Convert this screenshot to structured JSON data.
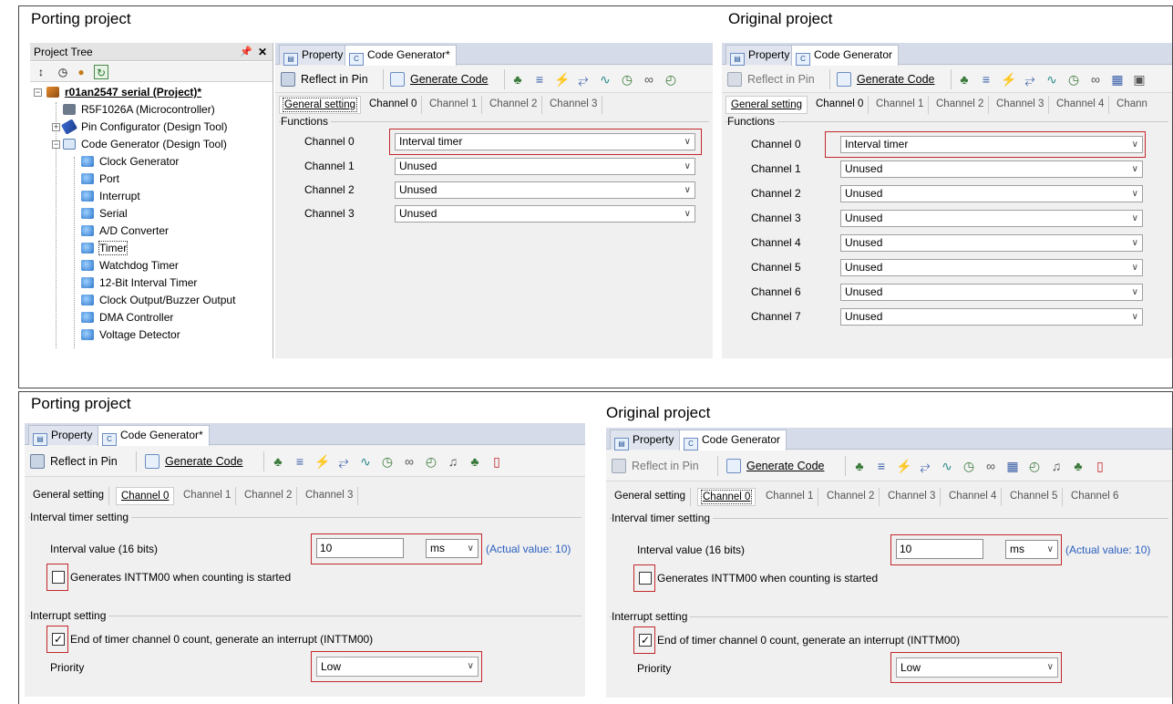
{
  "captions": {
    "top_left": "Porting project",
    "top_right": "Original project",
    "bottom_left": "Porting project",
    "bottom_right": "Original project"
  },
  "project_tree": {
    "title": "Project Tree",
    "pin": "  p",
    "close": "✕",
    "nodes": [
      "r01an2547 serial (Project)*",
      "R5F1026A (Microcontroller)",
      "Pin Configurator (Design Tool)",
      "Code Generator (Design Tool)",
      "Clock Generator",
      "Port",
      "Interrupt",
      "Serial",
      "A/D Converter",
      "Timer",
      "Watchdog Timer",
      "12-Bit Interval Timer",
      "Clock Output/Buzzer Output",
      "DMA Controller",
      "Voltage Detector"
    ]
  },
  "doc_tabs": {
    "property": "Property",
    "codegen_porting": "Code Generator*",
    "codegen_original": "Code Generator"
  },
  "toolbar": {
    "reflect": "Reflect in Pin",
    "generate": "Generate Code"
  },
  "periph_tabs": {
    "general": "General setting",
    "channels": [
      "Channel 0",
      "Channel 1",
      "Channel 2",
      "Channel 3",
      "Channel 4",
      "Channel 5",
      "Channel 6",
      "Chann"
    ]
  },
  "functions": {
    "group": "Functions",
    "channel_labels": [
      "Channel 0",
      "Channel 1",
      "Channel 2",
      "Channel 3",
      "Channel 4",
      "Channel 5",
      "Channel 6",
      "Channel 7"
    ],
    "porting_values": [
      "Interval timer",
      "Unused",
      "Unused",
      "Unused"
    ],
    "original_values": [
      "Interval timer",
      "Unused",
      "Unused",
      "Unused",
      "Unused",
      "Unused",
      "Unused",
      "Unused"
    ]
  },
  "channel0": {
    "interval_group": "Interval timer setting",
    "interval_label": "Interval value (16 bits)",
    "interval_value": "10",
    "unit": "ms",
    "actual": "(Actual value: 10)",
    "start_label": "Generates INTTM00 when counting is started",
    "start_checked": false,
    "interrupt_group": "Interrupt setting",
    "end_label": "End of timer channel 0 count, generate an interrupt (INTTM00)",
    "end_checked": true,
    "priority_label": "Priority",
    "priority_value": "Low"
  },
  "glyphs": {
    "chevron": "∨",
    "check": "✓"
  }
}
